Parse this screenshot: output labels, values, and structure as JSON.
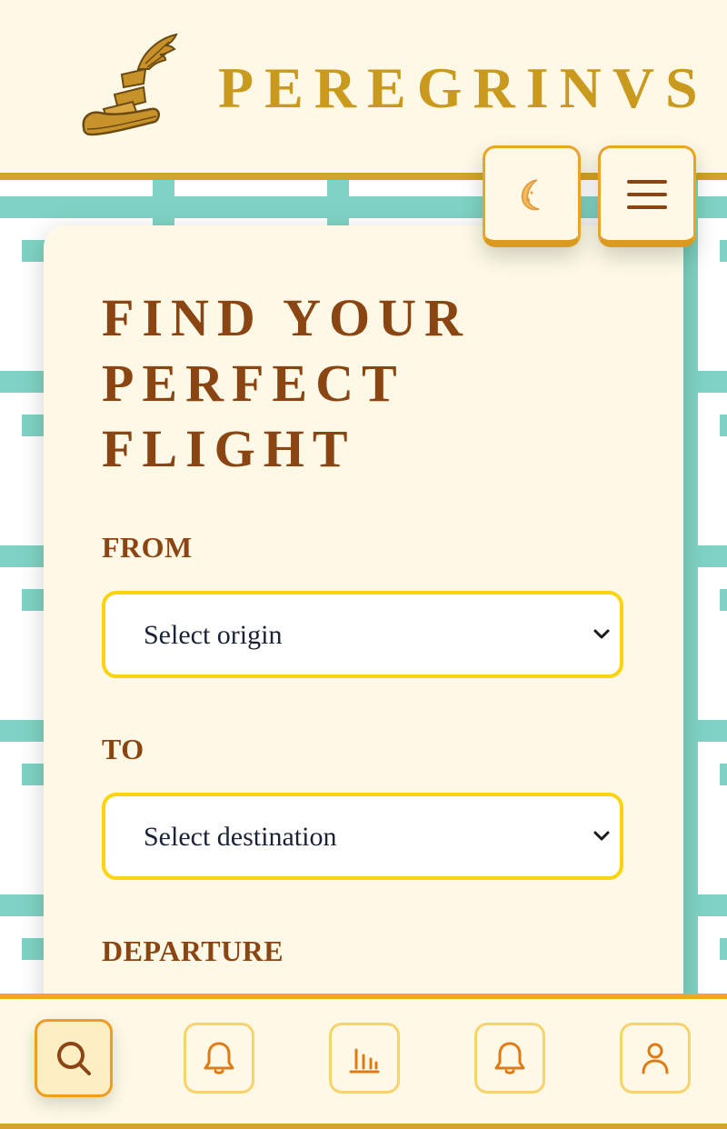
{
  "header": {
    "brand": "PEREGRINVS",
    "logo_icon": "winged-sandal-icon"
  },
  "controls": {
    "theme_toggle_icon": "moon-icon",
    "menu_icon": "hamburger-menu-icon"
  },
  "search_form": {
    "title_lines": [
      "FIND YOUR",
      "PERFECT",
      "FLIGHT"
    ],
    "from_label": "FROM",
    "from_value": "Select origin",
    "to_label": "TO",
    "to_value": "Select destination",
    "departure_label": "DEPARTURE"
  },
  "bottom_nav": {
    "items": [
      {
        "icon": "search-icon",
        "active": true
      },
      {
        "icon": "bell-icon",
        "active": false
      },
      {
        "icon": "bar-chart-icon",
        "active": false
      },
      {
        "icon": "bell-icon",
        "active": false
      },
      {
        "icon": "user-icon",
        "active": false
      }
    ]
  },
  "colors": {
    "background": "#fdf9e6",
    "gold": "#d4a32b",
    "brown": "#8b4513",
    "teal": "#7fd3c4",
    "yellow_border": "#fcd40e",
    "orange": "#f5a524"
  }
}
